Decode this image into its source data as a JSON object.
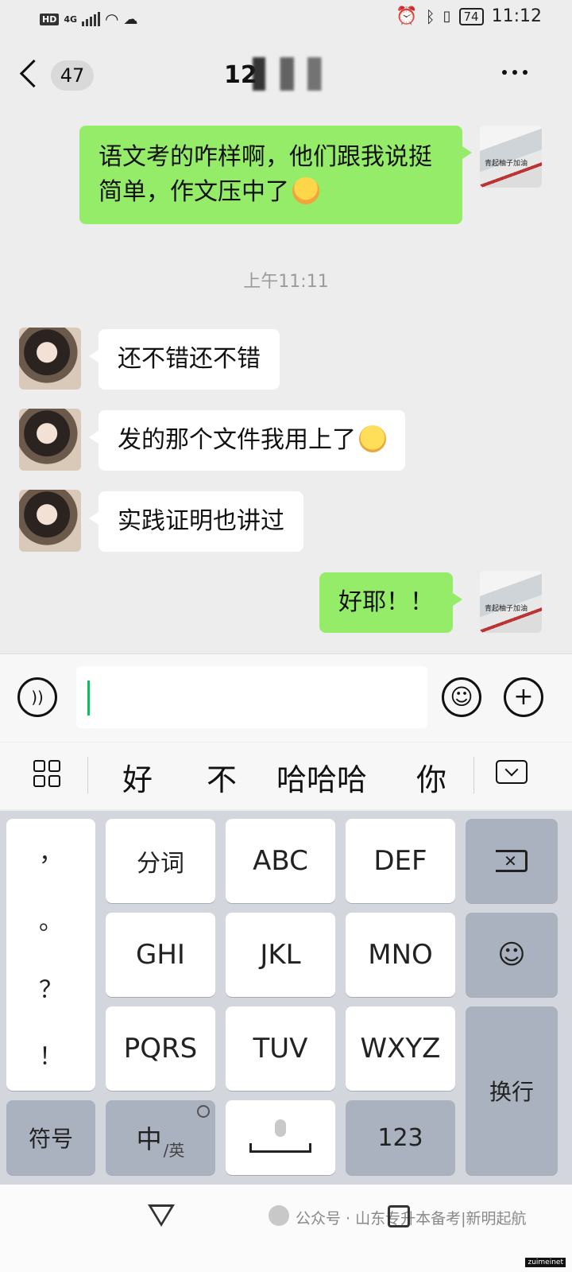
{
  "status_bar": {
    "hd": "HD",
    "network": "4G",
    "time": "11:12",
    "battery": "74",
    "icons": [
      "signal-icon",
      "wifi-icon",
      "chat-bubble-icon",
      "alarm-icon",
      "bluetooth-icon",
      "vibrate-icon"
    ]
  },
  "header": {
    "back_icon": "chevron-left-icon",
    "unread_count": "47",
    "title_visible": "12",
    "more_icon": "more-dots-icon"
  },
  "messages": [
    {
      "side": "me",
      "text": "语文考的咋样啊，他们跟我说挺简单，作文压中了",
      "emoji": "hugging-face-emoji"
    },
    {
      "side": "system",
      "text": "上午11:11"
    },
    {
      "side": "them",
      "text": "还不错还不错"
    },
    {
      "side": "them",
      "text": "发的那个文件我用上了",
      "emoji": "grinning-face-emoji"
    },
    {
      "side": "them",
      "text": "实践证明也讲过"
    },
    {
      "side": "me",
      "text": "好耶！！"
    }
  ],
  "self_avatar_text": "青起柚子加油",
  "input_bar": {
    "voice_icon": "voice-icon",
    "emoji_icon": "smiley-icon",
    "plus_icon": "plus-icon",
    "value": ""
  },
  "suggestions": {
    "menu_icon": "grid-menu-icon",
    "words": [
      "好",
      "不",
      "哈哈哈",
      "你"
    ],
    "hide_icon": "keyboard-hide-icon"
  },
  "keyboard": {
    "punctuation": [
      "，",
      "。",
      "？",
      "！"
    ],
    "row1": [
      "分词",
      "ABC",
      "DEF"
    ],
    "row2": [
      "GHI",
      "JKL",
      "MNO"
    ],
    "row3": [
      "PQRS",
      "TUV",
      "WXYZ"
    ],
    "backspace_icon": "backspace-icon",
    "emoji_key_icon": "smiley-icon",
    "enter": "换行",
    "symbols": "符号",
    "lang_main": "中",
    "lang_sub": "/英",
    "globe_icon": "globe-icon",
    "mic_icon": "microphone-icon",
    "numbers": "123"
  },
  "system_nav": {
    "back_icon": "triangle-back-icon",
    "recents_icon": "square-recents-icon",
    "watermark": "公众号 · 山东专升本备考|新明起航",
    "corner": "zuimeinet"
  }
}
